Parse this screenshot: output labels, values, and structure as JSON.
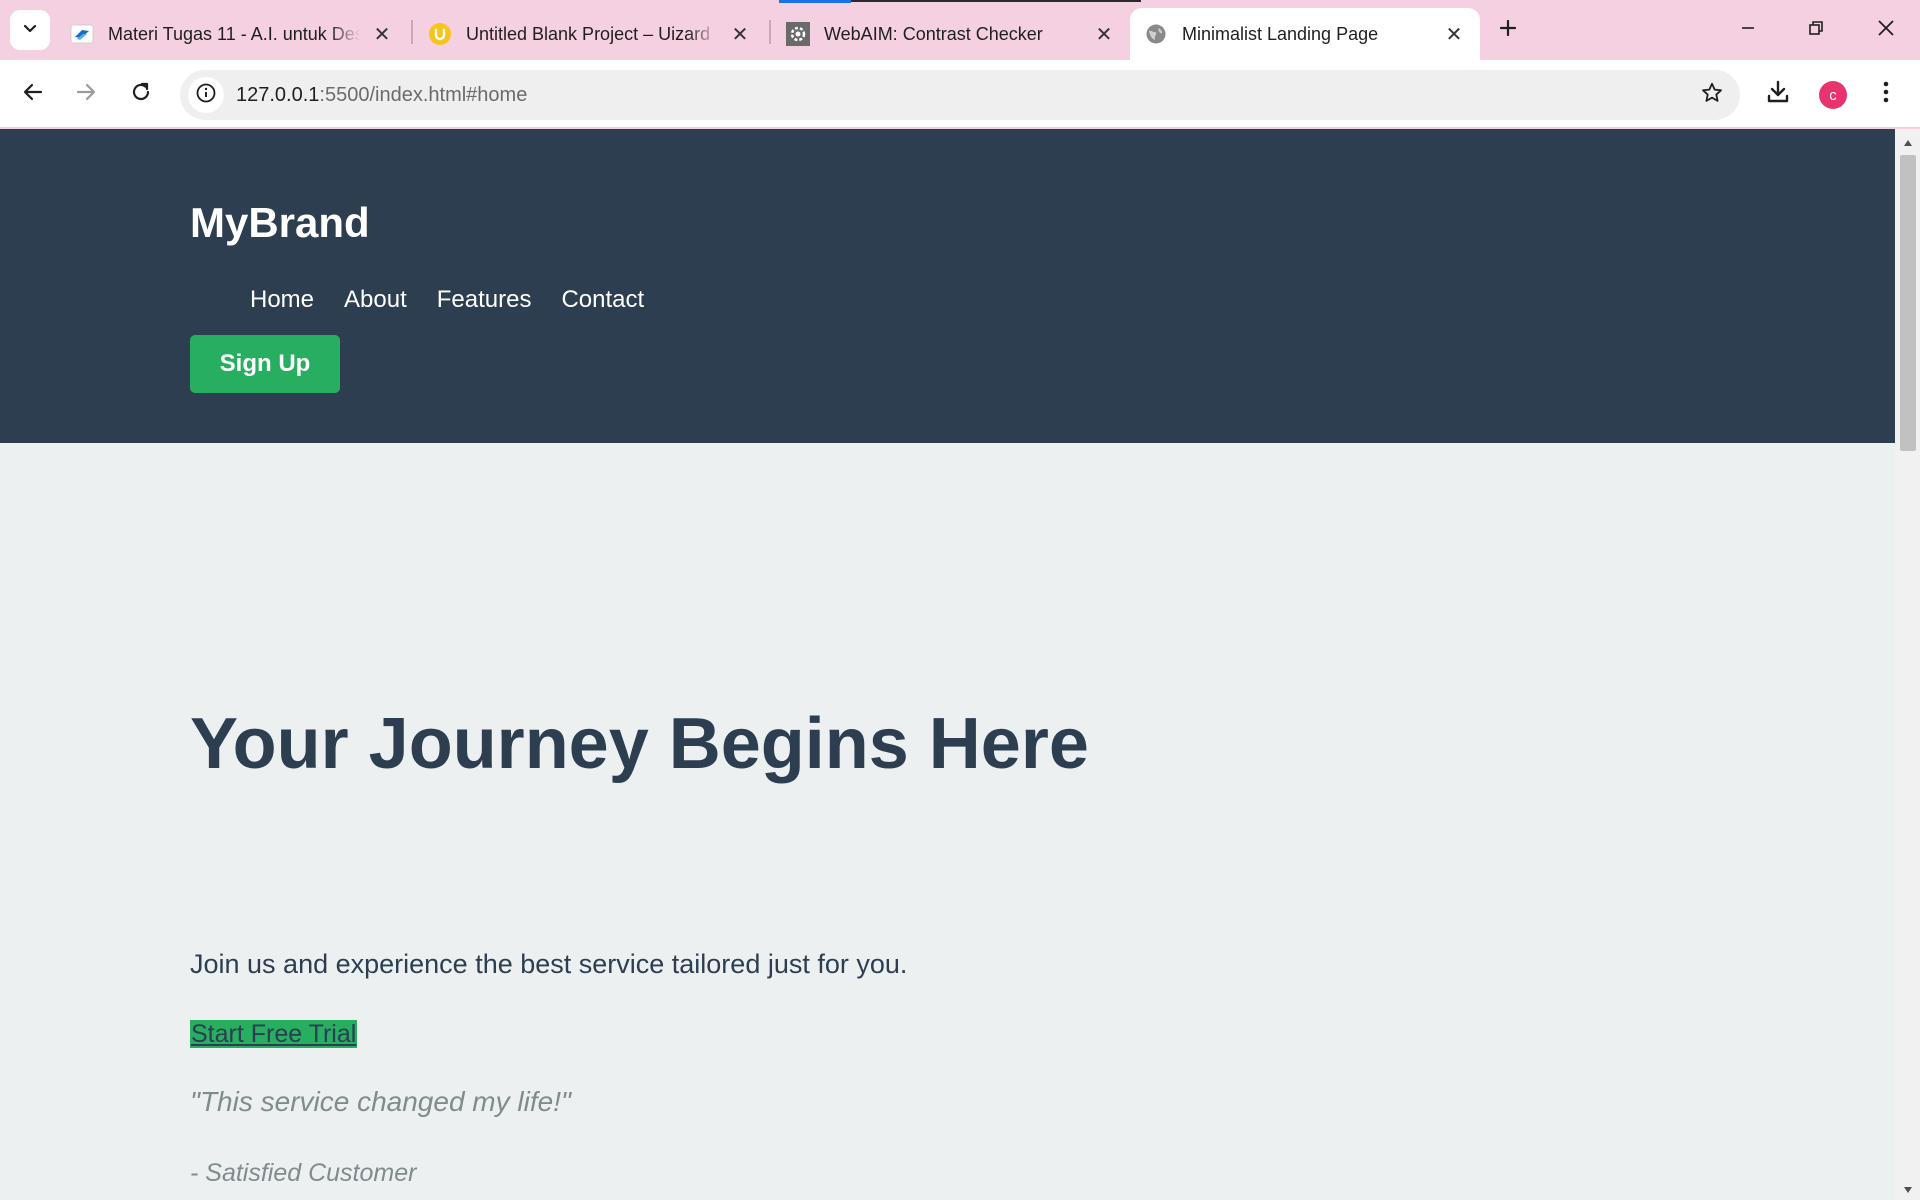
{
  "browser": {
    "tabs": [
      {
        "title": "Materi Tugas 11 - A.I. untuk Desain",
        "favicon": "kampus-logo-icon",
        "active": false
      },
      {
        "title": "Untitled Blank Project – Uizard",
        "favicon": "uizard-logo-icon",
        "active": false
      },
      {
        "title": "WebAIM: Contrast Checker",
        "favicon": "webaim-logo-icon",
        "active": false
      },
      {
        "title": "Minimalist Landing Page",
        "favicon": "globe-icon",
        "active": true
      }
    ],
    "address": {
      "host": "127.0.0.1",
      "rest": ":5500/index.html#home"
    },
    "profile_initial": "c",
    "colors": {
      "tabstrip": "#f5d0e0",
      "profile_avatar": "#e8336d",
      "loading_indicator": "#1a73e8"
    }
  },
  "site": {
    "brand": "MyBrand",
    "nav": [
      "Home",
      "About",
      "Features",
      "Contact"
    ],
    "signup_label": "Sign Up",
    "hero_title": "Your Journey Begins Here",
    "hero_subtitle": "Join us and experience the best service tailored just for you.",
    "cta_label": "Start Free Trial",
    "testimonial": "\"This service changed my life!\"",
    "testimonial_author": "- Satisfied Customer",
    "colors": {
      "header_bg": "#2c3e50",
      "page_bg": "#ecf0f1",
      "accent_green": "#27ae60",
      "text_dark": "#2c3e50",
      "text_muted": "#7f8c8d"
    }
  }
}
